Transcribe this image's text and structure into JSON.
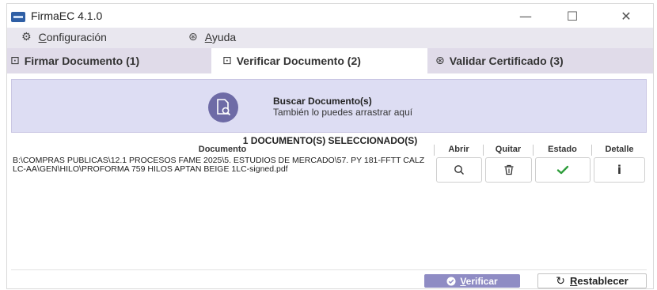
{
  "window": {
    "title": "FirmaEC 4.1.0",
    "minimize_glyph": "—",
    "maximize_glyph": "☐",
    "close_glyph": "✕"
  },
  "menu": [
    {
      "label": "Configuración",
      "icon": "gear-icon"
    },
    {
      "label": "Ayuda",
      "icon": "help-icon"
    }
  ],
  "tabs": [
    {
      "label": "Firmar Documento (1)",
      "icon": "sign-document-icon",
      "active": false
    },
    {
      "label": "Verificar Documento (2)",
      "icon": "verify-document-icon",
      "active": true
    },
    {
      "label": "Validar Certificado (3)",
      "icon": "certificate-icon",
      "active": false
    }
  ],
  "dropzone": {
    "title": "Buscar Documento(s)",
    "subtitle": "También lo puedes arrastrar aquí"
  },
  "selection": {
    "count_label": "1 DOCUMENTO(S) SELECCIONADO(S)"
  },
  "table": {
    "columns": [
      "Documento",
      "Abrir",
      "Quitar",
      "Estado",
      "Detalle"
    ],
    "rows": [
      {
        "document": "B:\\COMPRAS PUBLICAS\\12.1 PROCESOS FAME 2025\\5. ESTUDIOS DE MERCADO\\57. PY 181-FFTT CALZ LC-AA\\GEN\\HILO\\PROFORMA 759 HILOS APTAN BEIGE 1LC-signed.pdf",
        "open_icon": "search-icon",
        "remove_icon": "trash-icon",
        "status_icon": "checkmark-icon",
        "status_color": "#2e9d3b",
        "detail_icon": "info-icon"
      }
    ]
  },
  "actions": {
    "verify_label": "Verificar",
    "reset_label": "Restablecer"
  },
  "colors": {
    "accent": "#6e6ba6",
    "verify_button": "#8f8cc4",
    "dropzone_bg": "#ddddf3",
    "menubar_bg": "#e9e7ef",
    "tabs_bg": "#e0dbe9"
  }
}
